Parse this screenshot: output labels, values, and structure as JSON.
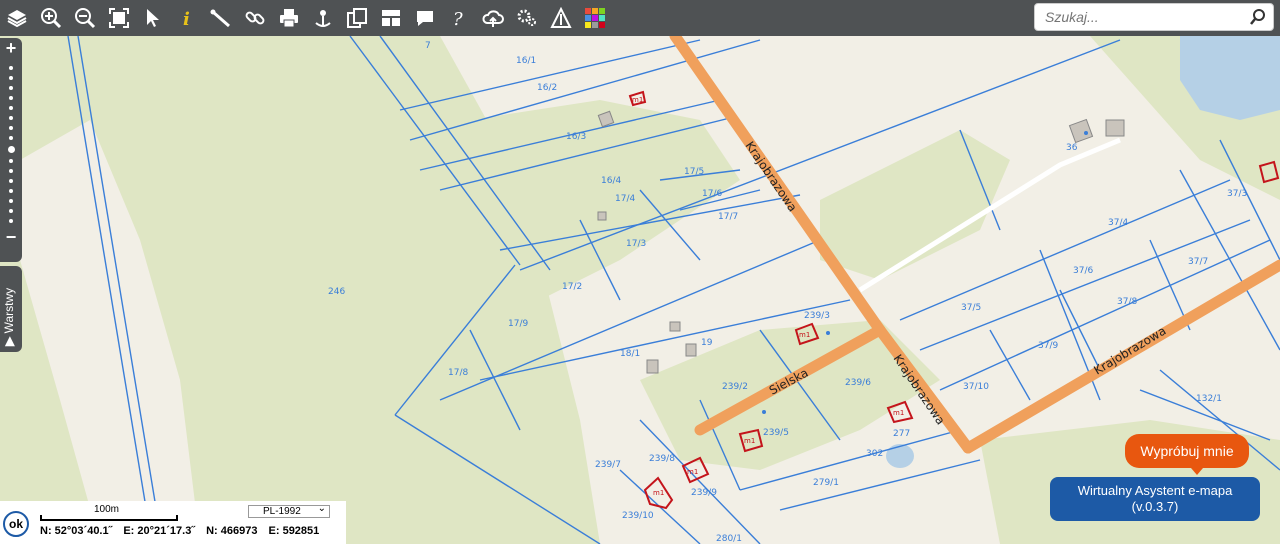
{
  "toolbar": {
    "icons": [
      "layers-icon",
      "zoom-in-icon",
      "zoom-out-icon",
      "full-extent-icon",
      "select-cursor-icon",
      "info-icon",
      "measure-distance-icon",
      "link-icon",
      "print-icon",
      "location-marker-icon",
      "copy-extent-icon",
      "layout-icon",
      "comment-icon",
      "help-icon",
      "cloud-upload-icon",
      "settings-icon",
      "road-sign-icon",
      "color-palette-icon"
    ],
    "help_label": "?"
  },
  "search": {
    "placeholder": "Szukaj..."
  },
  "zoom": {
    "plus": "+",
    "minus": "−"
  },
  "layers_tab": {
    "label": "Warstwy",
    "arrow": "▶"
  },
  "map": {
    "streets": [
      "Krajobrazowa",
      "Krajobrazowa",
      "Krajobrazowa",
      "Sielska"
    ],
    "parcels": [
      "7",
      "16/1",
      "16/2",
      "16/3",
      "16/4",
      "17/5",
      "17/6",
      "17/7",
      "17/4",
      "17/3",
      "17/2",
      "17/9",
      "17/8",
      "246",
      "18/1",
      "19",
      "239/3",
      "239/2",
      "239/6",
      "239/5",
      "239/8",
      "239/7",
      "239/9",
      "239/10",
      "277",
      "279/1",
      "280/1",
      "302",
      "36",
      "37/3",
      "37/4",
      "37/6",
      "37/7",
      "37/5",
      "37/8",
      "37/9",
      "37/10",
      "132/1"
    ],
    "building_label": "m1"
  },
  "scale": {
    "label": "100m",
    "crs": "PL-1992",
    "ok_label": "ok"
  },
  "coordinates": {
    "lat": "N: 52°03´40.1˝",
    "lon": "E: 20°21´17.3˝",
    "north": "N: 466973",
    "east": "E: 592851"
  },
  "buttons": {
    "try_me": "Wypróbuj mnie",
    "assistant_line1": "Wirtualny Asystent e-mapa",
    "assistant_line2": "(v.0.3.7)"
  },
  "colors": {
    "toolbar": "#4f5254",
    "parcel_line": "#3a7ed8",
    "road": "#f0a05c",
    "green_area": "#dfe6c4",
    "building_outline": "#c4141b",
    "try_button": "#e8570f",
    "assistant_button": "#1d5aa6"
  }
}
